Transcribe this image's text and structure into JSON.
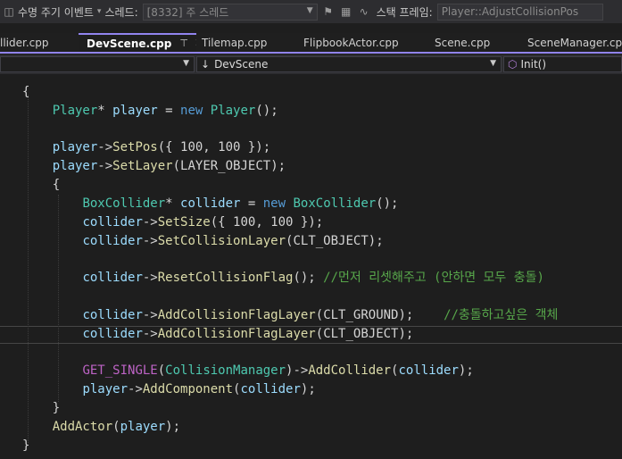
{
  "debug_toolbar": {
    "lifecycle_label": "수명 주기 이벤트",
    "thread_label": "스레드:",
    "thread_value": "[8332] 주 스레드",
    "stack_frame_label": "스택 프레임:",
    "stack_frame_value": "Player::AdjustCollisionPos"
  },
  "tabs": [
    {
      "label": "llider.cpp",
      "active": false
    },
    {
      "label": "DevScene.cpp",
      "active": true
    },
    {
      "label": "Tilemap.cpp",
      "active": false
    },
    {
      "label": "FlipbookActor.cpp",
      "active": false
    },
    {
      "label": "Scene.cpp",
      "active": false
    },
    {
      "label": "SceneManager.cpp",
      "active": false
    }
  ],
  "navbar": {
    "scope": "DevScene",
    "member": "Init()"
  },
  "code_lines": [
    [
      [
        "{",
        "d"
      ]
    ],
    [
      [
        "    ",
        "d"
      ],
      [
        "Player",
        "t"
      ],
      [
        "* ",
        "d"
      ],
      [
        "player",
        "v"
      ],
      [
        " = ",
        "d"
      ],
      [
        "new",
        "k"
      ],
      [
        " ",
        "d"
      ],
      [
        "Player",
        "t"
      ],
      [
        "();",
        "d"
      ]
    ],
    [
      [
        "",
        "d"
      ]
    ],
    [
      [
        "    ",
        "d"
      ],
      [
        "player",
        "v"
      ],
      [
        "->",
        "d"
      ],
      [
        "SetPos",
        "f"
      ],
      [
        "({ 100, 100 });",
        "d"
      ]
    ],
    [
      [
        "    ",
        "d"
      ],
      [
        "player",
        "v"
      ],
      [
        "->",
        "d"
      ],
      [
        "SetLayer",
        "f"
      ],
      [
        "(",
        "d"
      ],
      [
        "LAYER_OBJECT",
        "d"
      ],
      [
        ");",
        "d"
      ]
    ],
    [
      [
        "    {",
        "d"
      ]
    ],
    [
      [
        "        ",
        "d"
      ],
      [
        "BoxCollider",
        "t"
      ],
      [
        "* ",
        "d"
      ],
      [
        "collider",
        "v"
      ],
      [
        " = ",
        "d"
      ],
      [
        "new",
        "k"
      ],
      [
        " ",
        "d"
      ],
      [
        "BoxCollider",
        "t"
      ],
      [
        "();",
        "d"
      ]
    ],
    [
      [
        "        ",
        "d"
      ],
      [
        "collider",
        "v"
      ],
      [
        "->",
        "d"
      ],
      [
        "SetSize",
        "f"
      ],
      [
        "({ 100, 100 });",
        "d"
      ]
    ],
    [
      [
        "        ",
        "d"
      ],
      [
        "collider",
        "v"
      ],
      [
        "->",
        "d"
      ],
      [
        "SetCollisionLayer",
        "f"
      ],
      [
        "(",
        "d"
      ],
      [
        "CLT_OBJECT",
        "d"
      ],
      [
        ");",
        "d"
      ]
    ],
    [
      [
        "",
        "d"
      ]
    ],
    [
      [
        "        ",
        "d"
      ],
      [
        "collider",
        "v"
      ],
      [
        "->",
        "d"
      ],
      [
        "ResetCollisionFlag",
        "f"
      ],
      [
        "(); ",
        "d"
      ],
      [
        "//먼저 리셋해주고 (안하면 모두 충돌)",
        "c"
      ]
    ],
    [
      [
        "",
        "d"
      ]
    ],
    [
      [
        "        ",
        "d"
      ],
      [
        "collider",
        "v"
      ],
      [
        "->",
        "d"
      ],
      [
        "AddCollisionFlagLayer",
        "f"
      ],
      [
        "(",
        "d"
      ],
      [
        "CLT_GROUND",
        "d"
      ],
      [
        ");    ",
        "d"
      ],
      [
        "//충돌하고싶은 객체",
        "c"
      ]
    ],
    [
      [
        "        ",
        "d"
      ],
      [
        "collider",
        "v"
      ],
      [
        "->",
        "d"
      ],
      [
        "AddCollisionFlagLayer",
        "f"
      ],
      [
        "(",
        "d"
      ],
      [
        "CLT_OBJECT",
        "d"
      ],
      [
        ");",
        "d"
      ]
    ],
    [
      [
        "",
        "d"
      ]
    ],
    [
      [
        "        ",
        "d"
      ],
      [
        "GET_SINGLE",
        "m"
      ],
      [
        "(",
        "d"
      ],
      [
        "CollisionManager",
        "t"
      ],
      [
        ")->",
        "d"
      ],
      [
        "AddCollider",
        "f"
      ],
      [
        "(",
        "d"
      ],
      [
        "collider",
        "v"
      ],
      [
        ");",
        "d"
      ]
    ],
    [
      [
        "        ",
        "d"
      ],
      [
        "player",
        "v"
      ],
      [
        "->",
        "d"
      ],
      [
        "AddComponent",
        "f"
      ],
      [
        "(",
        "d"
      ],
      [
        "collider",
        "v"
      ],
      [
        ");",
        "d"
      ]
    ],
    [
      [
        "    }",
        "d"
      ]
    ],
    [
      [
        "    ",
        "d"
      ],
      [
        "AddActor",
        "f"
      ],
      [
        "(",
        "d"
      ],
      [
        "player",
        "v"
      ],
      [
        ");",
        "d"
      ]
    ],
    [
      [
        "}",
        "d"
      ]
    ]
  ],
  "colors": {
    "keyword": "#569cd6",
    "type": "#4ec9b0",
    "function": "#dcdcaa",
    "variable": "#9cdcfe",
    "comment": "#57a64a",
    "macro": "#bd63c5",
    "default": "#d4d4d4",
    "accent": "#9184ee"
  },
  "icons": [
    "lifecycle-icon",
    "thread-filter-icon",
    "flag-icon",
    "flagged-threads-icon",
    "stack-icon",
    "down-arrow-icon",
    "class-icon"
  ]
}
